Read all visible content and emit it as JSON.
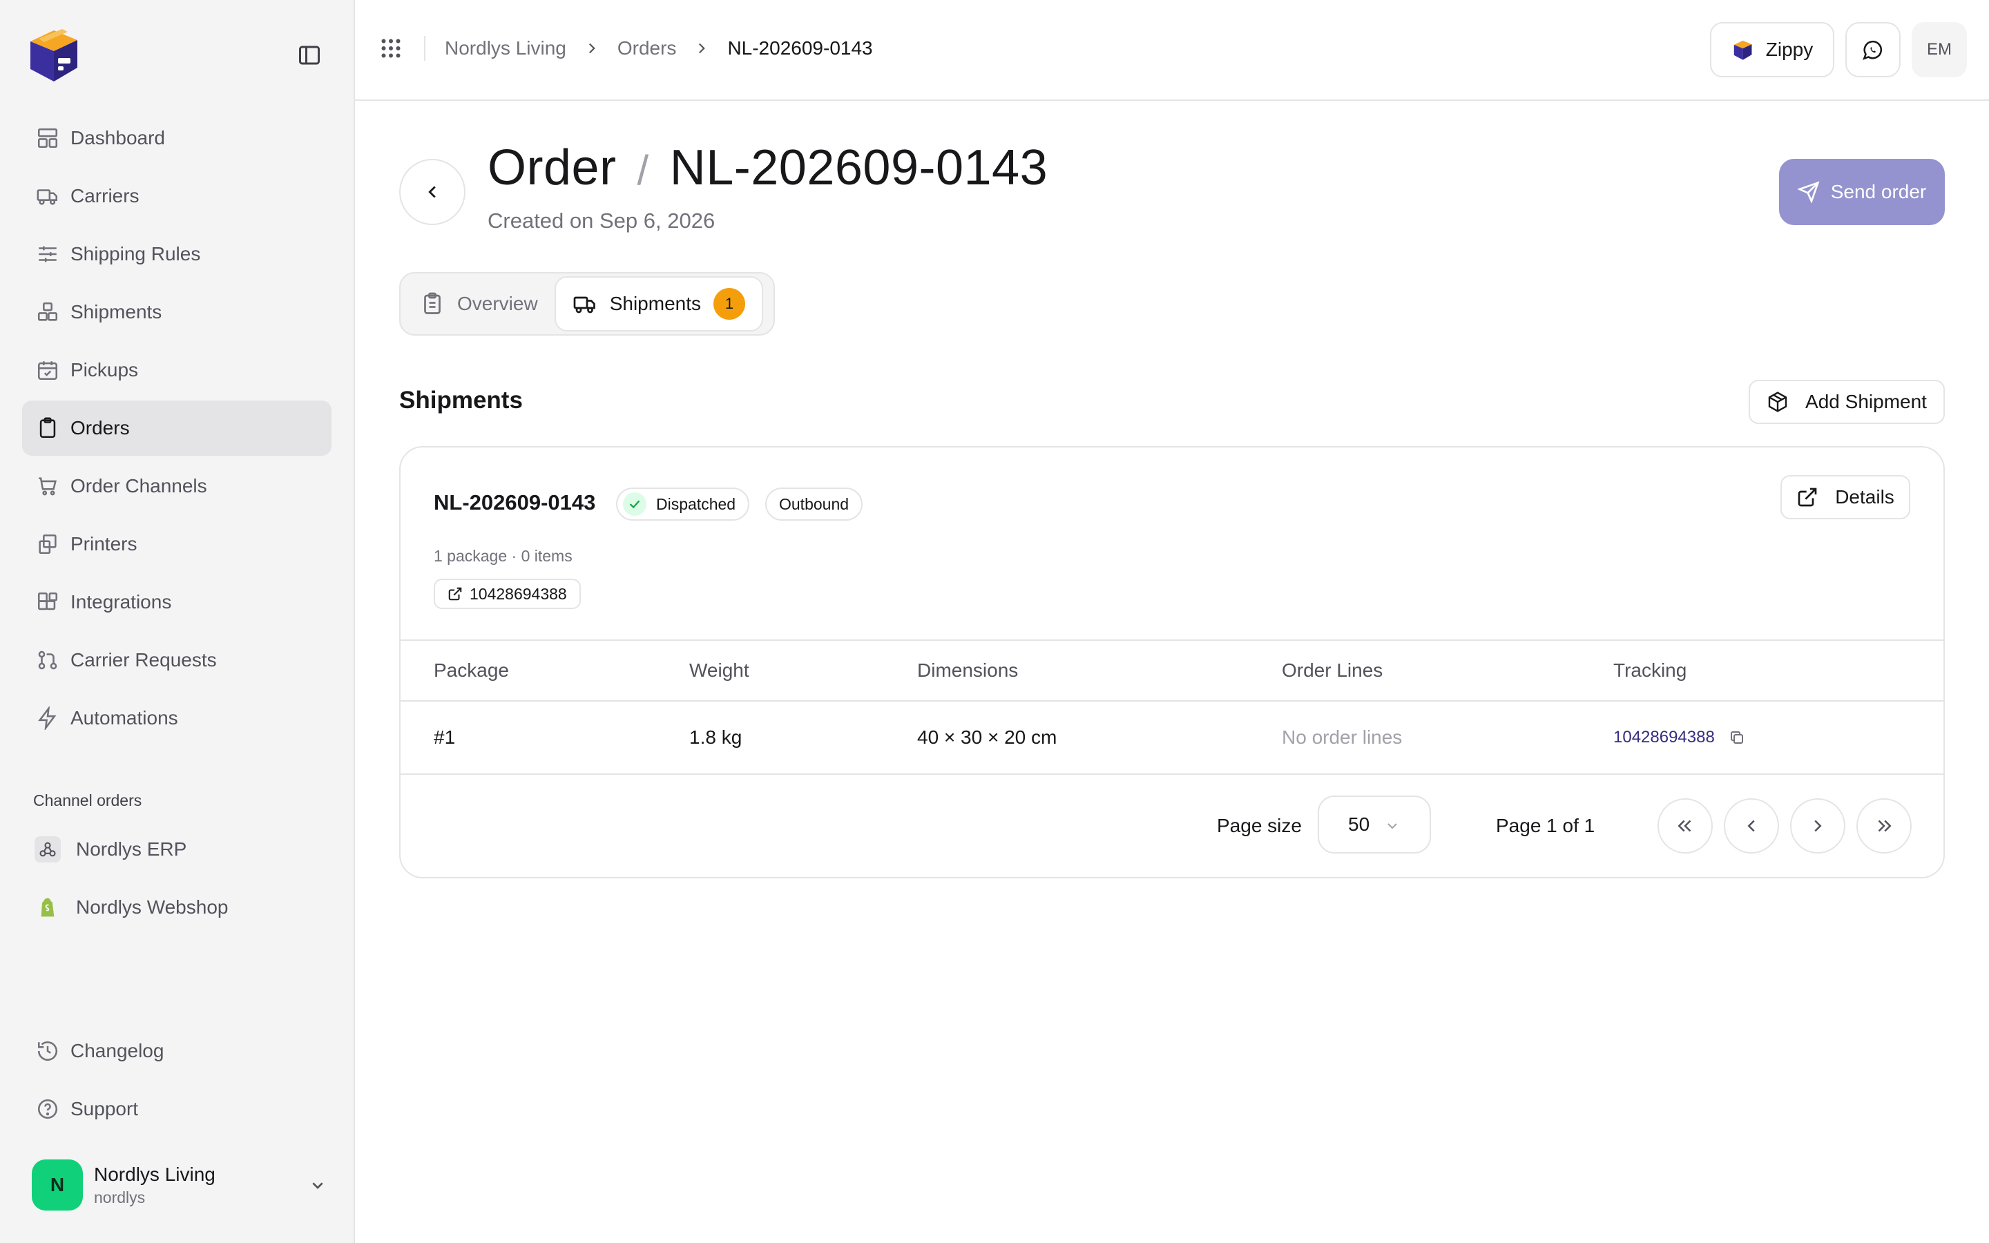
{
  "sidebar": {
    "nav": [
      {
        "label": "Dashboard",
        "icon": "layout-icon"
      },
      {
        "label": "Carriers",
        "icon": "truck-icon"
      },
      {
        "label": "Shipping Rules",
        "icon": "sliders-icon"
      },
      {
        "label": "Shipments",
        "icon": "boxes-icon"
      },
      {
        "label": "Pickups",
        "icon": "calendar-check-icon"
      },
      {
        "label": "Orders",
        "icon": "clipboard-icon",
        "active": true
      },
      {
        "label": "Order Channels",
        "icon": "cart-icon"
      },
      {
        "label": "Printers",
        "icon": "printer-icon"
      },
      {
        "label": "Integrations",
        "icon": "blocks-icon"
      },
      {
        "label": "Carrier Requests",
        "icon": "git-pull-request-icon"
      },
      {
        "label": "Automations",
        "icon": "zap-icon"
      }
    ],
    "channel_section_label": "Channel orders",
    "channels": [
      {
        "label": "Nordlys ERP",
        "icon": "webhook-icon"
      },
      {
        "label": "Nordlys Webshop",
        "icon": "shopify-bag-icon"
      }
    ],
    "bottom": [
      {
        "label": "Changelog",
        "icon": "history-icon"
      },
      {
        "label": "Support",
        "icon": "help-circle-icon"
      }
    ],
    "account": {
      "initial": "N",
      "name": "Nordlys Living",
      "slug": "nordlys"
    }
  },
  "topbar": {
    "breadcrumbs": [
      "Nordlys Living",
      "Orders",
      "NL-202609-0143"
    ],
    "app_button_label": "Zippy",
    "user_initials": "EM"
  },
  "page": {
    "title_prefix": "Order",
    "title_sep": "/",
    "order_number": "NL-202609-0143",
    "created": "Created on Sep 6, 2026",
    "send_label": "Send order"
  },
  "tabs": [
    {
      "label": "Overview",
      "active": false
    },
    {
      "label": "Shipments",
      "active": true,
      "badge": "1"
    }
  ],
  "shipments": {
    "section_title": "Shipments",
    "add_label": "Add Shipment",
    "card": {
      "id": "NL-202609-0143",
      "status": "Dispatched",
      "direction": "Outbound",
      "details_label": "Details",
      "meta": "1 package · 0 items",
      "tracking_chip": "10428694388"
    },
    "columns": [
      "Package",
      "Weight",
      "Dimensions",
      "Order Lines",
      "Tracking"
    ],
    "rows": [
      {
        "package": "#1",
        "weight": "1.8 kg",
        "dimensions": "40 × 30 × 20 cm",
        "order_lines": "No order lines",
        "tracking": "10428694388"
      }
    ],
    "pagination": {
      "page_size_label": "Page size",
      "page_size": "50",
      "page_info": "Page 1 of 1"
    }
  },
  "colors": {
    "accent": "#9493cf",
    "badge": "#f59e0b",
    "status_green": "#16a34a",
    "avatar_green": "#10d07a",
    "link": "#312e81"
  }
}
